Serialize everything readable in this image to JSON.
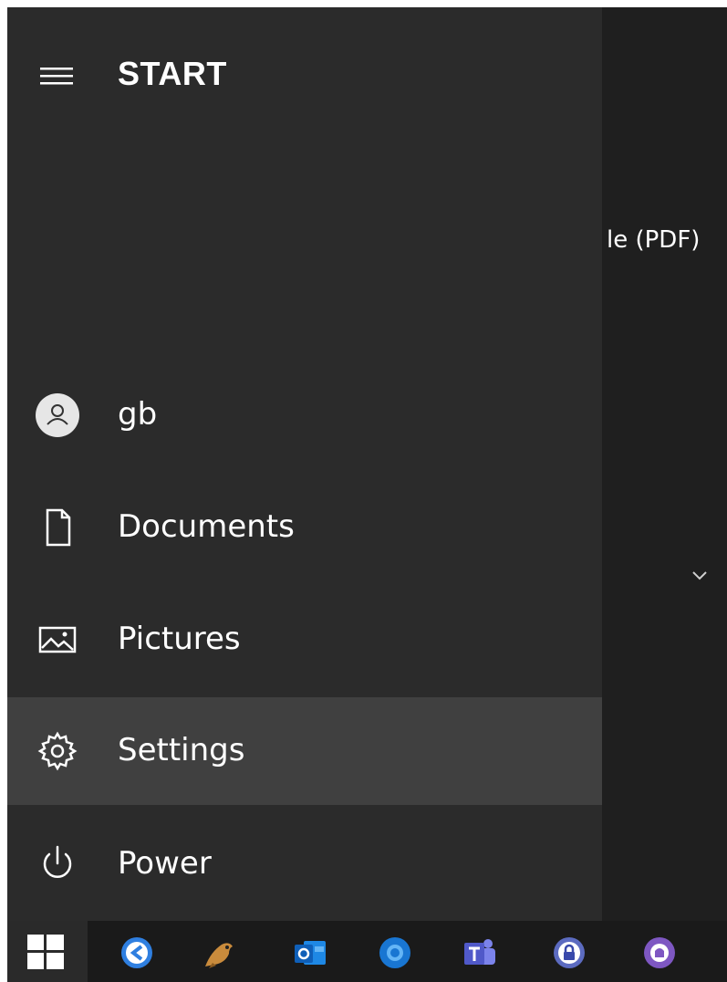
{
  "start_menu": {
    "title": "START",
    "nav_items": [
      {
        "label": "gb",
        "icon": "user-avatar-icon"
      },
      {
        "label": "Documents",
        "icon": "document-icon"
      },
      {
        "label": "Pictures",
        "icon": "pictures-icon"
      },
      {
        "label": "Settings",
        "icon": "gear-icon",
        "active": true
      },
      {
        "label": "Power",
        "icon": "power-icon"
      }
    ]
  },
  "background_app_list": {
    "visible_text": "le (PDF)",
    "chevron": "chevron-down-icon"
  },
  "taskbar": {
    "apps": [
      "windows-start-icon",
      "app-blue-c-icon",
      "app-bird-icon",
      "outlook-icon",
      "browser-blue-icon",
      "teams-icon",
      "lock-app-icon",
      "github-icon"
    ]
  },
  "colors": {
    "rail_bg": "#2b2b2b",
    "active_bg": "#404040",
    "app_list_bg": "#1f1f1f",
    "taskbar_bg": "#1a1a1a",
    "text": "#ffffff"
  }
}
